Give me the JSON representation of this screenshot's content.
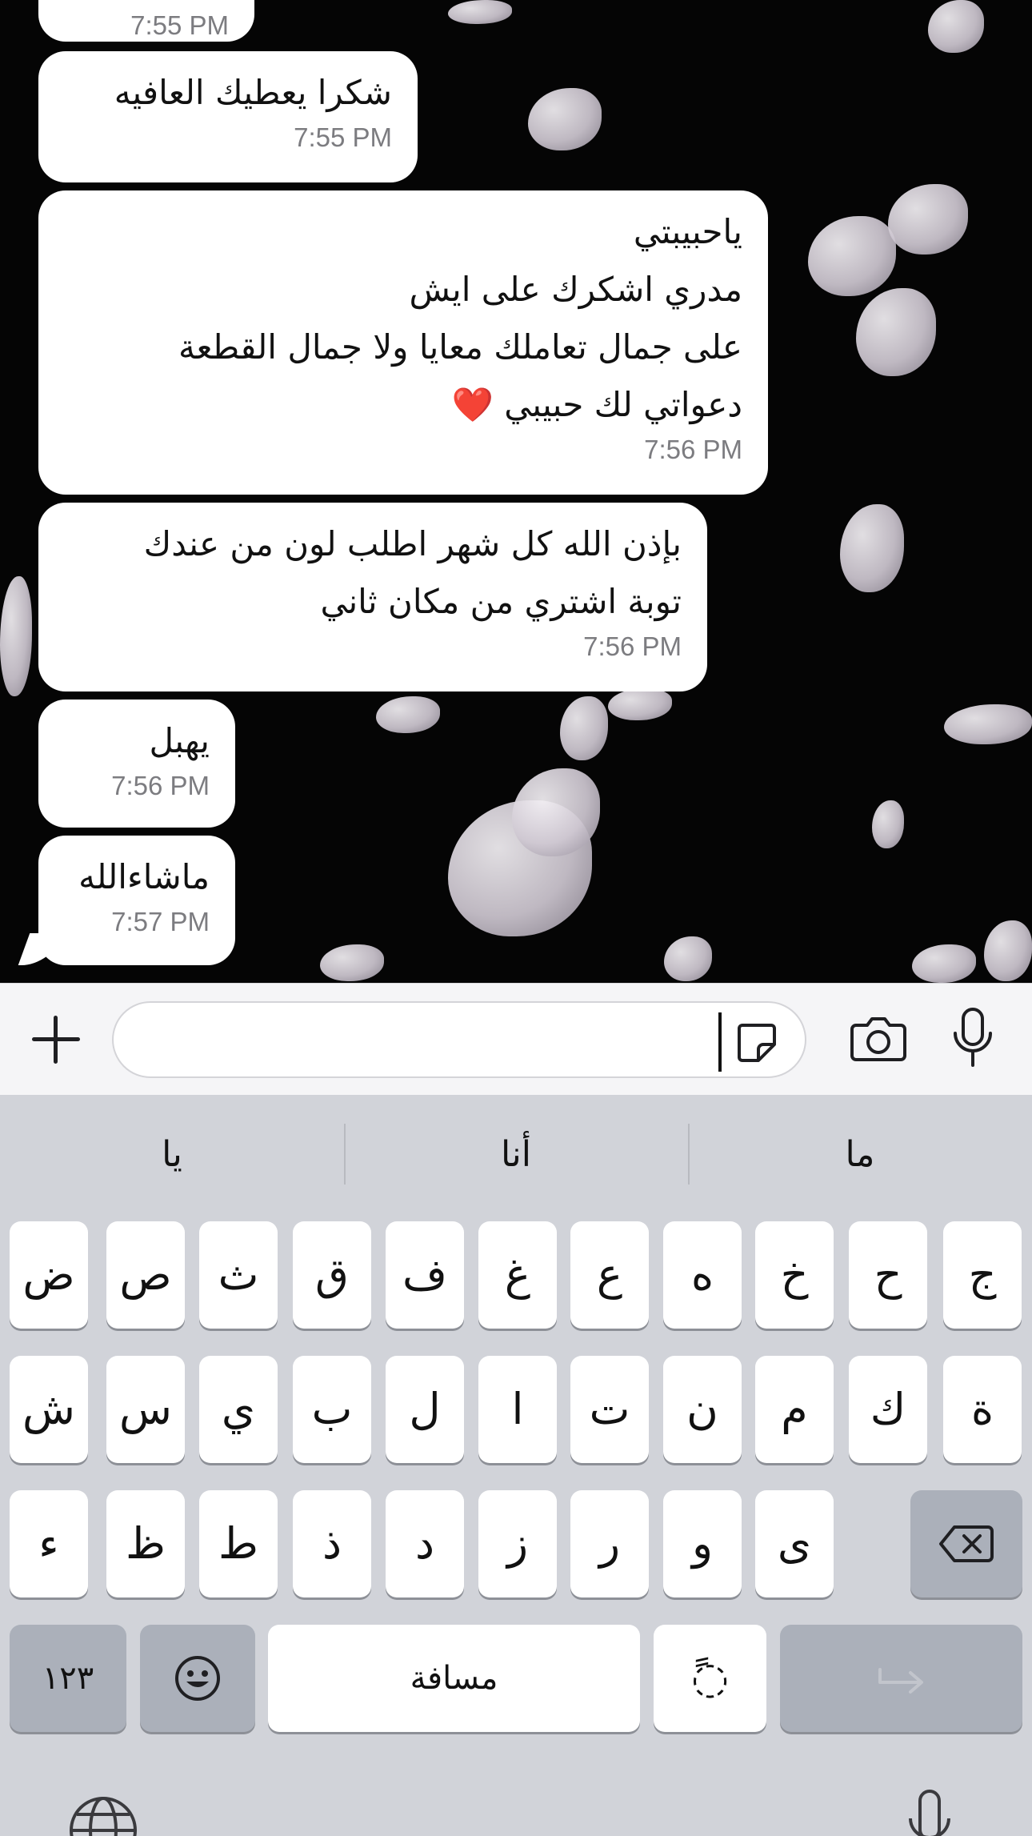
{
  "messages": [
    {
      "text": "",
      "time": "7:55 PM"
    },
    {
      "text": "شكرا يعطيك العافيه",
      "time": "7:55 PM"
    },
    {
      "text": "ياحبيبتي\nمدري اشكرك على ايش\nعلى جمال تعاملك معايا ولا جمال القطعة\nدعواتي لك حبيبي ❤️",
      "time": "7:56 PM"
    },
    {
      "text": "بإذن الله كل شهر اطلب لون من عندك\nتوبة اشتري من مكان ثاني",
      "time": "7:56 PM"
    },
    {
      "text": "يهبل",
      "time": "7:56 PM"
    },
    {
      "text": "ماشاءالله",
      "time": "7:57 PM"
    }
  ],
  "input_bar": {
    "message_value": "",
    "icons": [
      "plus-icon",
      "sticker-icon",
      "camera-icon",
      "microphone-icon"
    ]
  },
  "keyboard": {
    "suggestions": [
      "يا",
      "أنا",
      "ما"
    ],
    "row1": [
      "ض",
      "ص",
      "ث",
      "ق",
      "ف",
      "غ",
      "ع",
      "ه",
      "خ",
      "ح",
      "ج"
    ],
    "row2": [
      "ش",
      "س",
      "ي",
      "ب",
      "ل",
      "ا",
      "ت",
      "ن",
      "م",
      "ك",
      "ة"
    ],
    "row3": [
      "ء",
      "ظ",
      "ط",
      "ذ",
      "د",
      "ز",
      "ر",
      "و",
      "ى"
    ],
    "numbers_key": "١٢٣",
    "space_key": "مسافة",
    "diacritic_key": "ً◌"
  },
  "colors": {
    "bubble": "#ffffff",
    "timestamp": "#7c7c80",
    "keyboard_bg": "#d1d3d9",
    "key_bg": "#ffffff",
    "dark_key_bg": "#abb0ba"
  }
}
